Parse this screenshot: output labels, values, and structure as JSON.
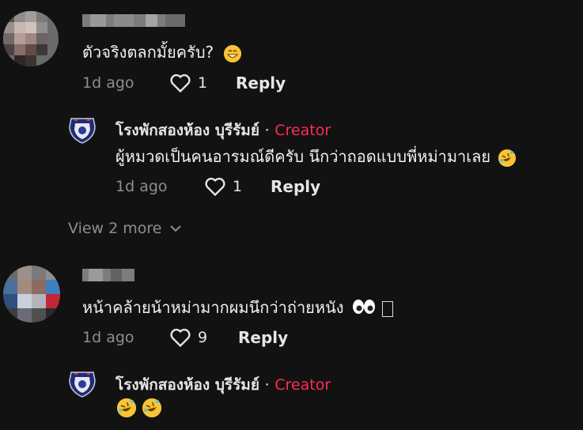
{
  "comments": [
    {
      "text": "ตัวจริงตลกมั้ยครับ?",
      "time": "1d ago",
      "likes": "1",
      "reply_label": "Reply",
      "reply": {
        "author": "โรงพักสองห้อง บุรีรัมย์",
        "separator": "·",
        "badge": "Creator",
        "text": "ผู้หมวดเป็นคนอารมณ์ดีครับ นึกว่าถอดแบบพี่หม่ามาเลย",
        "time": "1d ago",
        "likes": "1",
        "reply_label": "Reply"
      },
      "view_more": "View 2 more"
    },
    {
      "text": "หน้าคล้ายน้าหม่ามากผมนึกว่าถ่ายหนัง",
      "trailing_glyph": "👀",
      "time": "1d ago",
      "likes": "9",
      "reply_label": "Reply",
      "reply": {
        "author": "โรงพักสองห้อง บุรีรัมย์",
        "separator": "·",
        "badge": "Creator",
        "text": "",
        "emojis": [
          "rofl",
          "rofl"
        ]
      }
    }
  ],
  "colors": {
    "background": "#121212",
    "creator_accent": "#fe2c55",
    "muted": "#8e8e8e"
  }
}
